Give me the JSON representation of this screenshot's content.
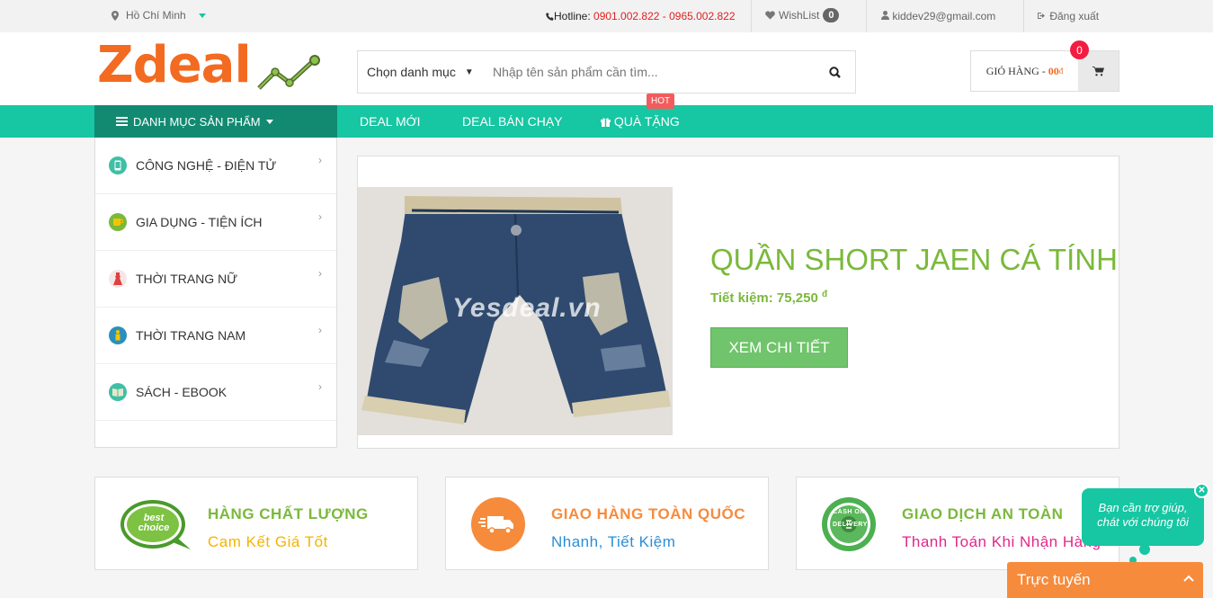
{
  "topbar": {
    "location": "Hồ Chí Minh",
    "hotline_label": "Hotline:",
    "hotline_numbers": "0901.002.822 - 0965.002.822",
    "wishlist_label": "WishList",
    "wishlist_count": "0",
    "user_email": "kiddev29@gmail.com",
    "logout_label": "Đăng xuất"
  },
  "header": {
    "logo_text": "Zdeal",
    "category_select": "Chọn danh mục",
    "search_placeholder": "Nhập tên sản phẩm cần tìm...",
    "cart_label": "GIỎ HÀNG -",
    "cart_amount": "00",
    "cart_currency": "đ",
    "cart_count": "0"
  },
  "nav": {
    "categories_label": "DANH MỤC SẢN PHẨM",
    "items": [
      "DEAL MỚI",
      "DEAL BÁN CHẠY",
      "QUÀ TẶNG"
    ],
    "hot_badge": "HOT"
  },
  "sidebar": {
    "items": [
      {
        "label": "CÔNG NGHỆ - ĐIỆN TỬ",
        "icon": "phone-icon",
        "color": "#3fbfa5"
      },
      {
        "label": "GIA DỤNG - TIỆN ÍCH",
        "icon": "cup-icon",
        "color": "#7ab93b"
      },
      {
        "label": "THỜI TRANG NỮ",
        "icon": "dress-icon",
        "color": "#e04040"
      },
      {
        "label": "THỜI TRANG NAM",
        "icon": "shirt-icon",
        "color": "#2a8fbd"
      },
      {
        "label": "SÁCH - EBOOK",
        "icon": "book-icon",
        "color": "#3fbfa5"
      }
    ]
  },
  "banner": {
    "watermark": "Yesdeal.vn",
    "title": "QUẦN SHORT JAEN CÁ TÍNH",
    "save_label": "Tiết kiệm: 75,250",
    "save_currency": "đ",
    "button": "XEM CHI TIẾT"
  },
  "features": [
    {
      "title": "HÀNG CHẤT LƯỢNG",
      "subtitle": "Cam Kết Giá Tốt",
      "icon": "best-choice-icon",
      "title_color": "#7ab93b",
      "sub_color": "#f5b400",
      "badge_text": "best choice"
    },
    {
      "title": "GIAO HÀNG TOÀN QUỐC",
      "subtitle": "Nhanh, Tiết Kiệm",
      "icon": "delivery-truck-icon",
      "title_color": "#f68b3c",
      "sub_color": "#2a8fd6"
    },
    {
      "title": "GIAO DỊCH AN TOÀN",
      "subtitle": "Thanh Toán Khi Nhận Hàng",
      "icon": "cash-on-delivery-icon",
      "title_color": "#7ab93b",
      "sub_color": "#e0288a",
      "badge_text": "CASH ON DELIVERY"
    }
  ],
  "chat": {
    "bubble_line1": "Bạn cần trợ giúp,",
    "bubble_line2": "chát với chúng tôi",
    "bar_label": "Trực tuyến"
  }
}
